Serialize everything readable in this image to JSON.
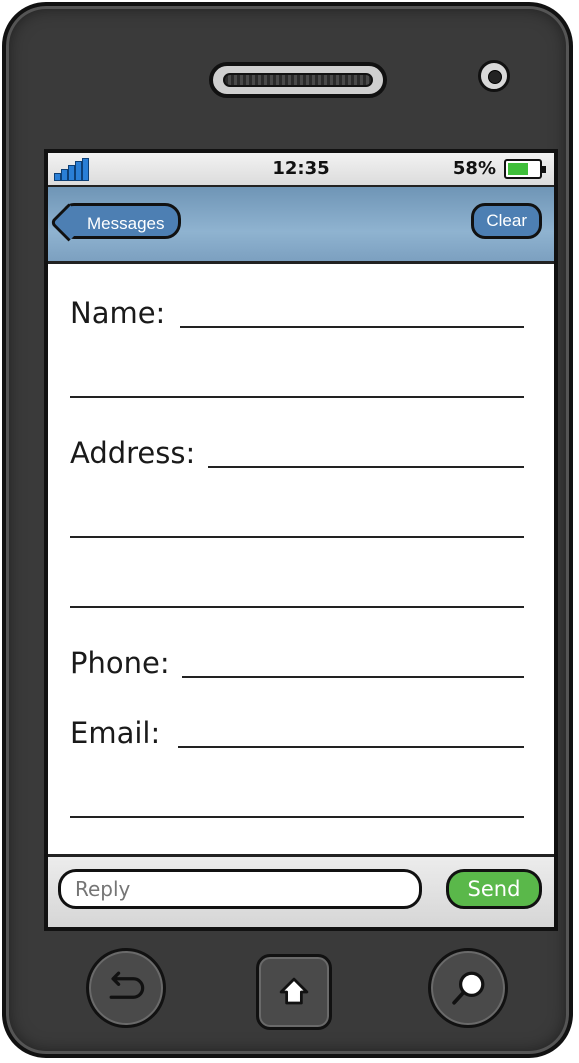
{
  "status_bar": {
    "time": "12:35",
    "battery_percent": "58%",
    "battery_level": 0.58,
    "signal_bars": 5
  },
  "nav": {
    "back_label": "Messages",
    "clear_label": "Clear"
  },
  "form": {
    "name_label": "Name:",
    "address_label": "Address:",
    "phone_label": "Phone:",
    "email_label": "Email:"
  },
  "reply": {
    "placeholder": "Reply",
    "send_label": "Send"
  },
  "colors": {
    "nav_blue": "#4d7fb3",
    "send_green": "#5ab84a",
    "battery_green": "#3fbf3a",
    "signal_blue": "#2a7fd6"
  },
  "icons": [
    "signal-icon",
    "battery-icon",
    "back-arrow-icon",
    "home-icon",
    "search-icon",
    "speaker-grille",
    "camera-lens"
  ]
}
